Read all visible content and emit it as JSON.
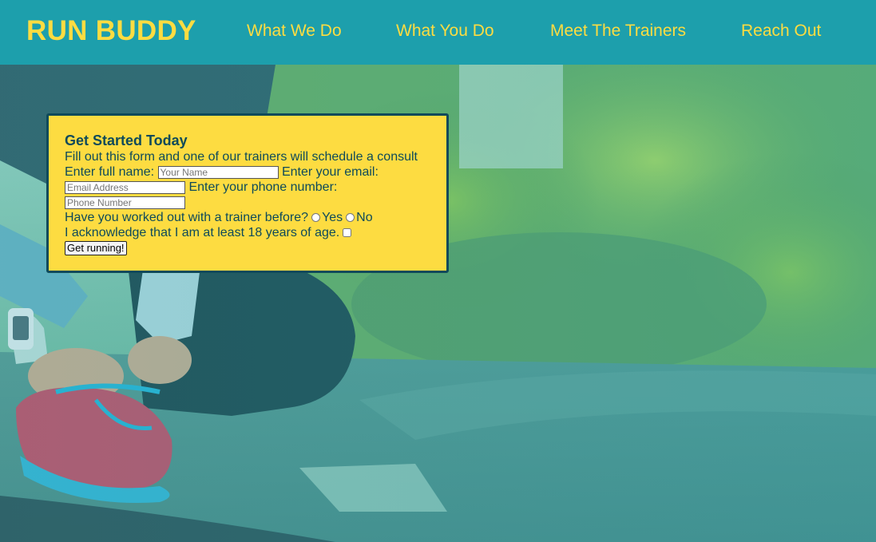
{
  "header": {
    "logo": "RUN BUDDY",
    "nav": [
      "What We Do",
      "What You Do",
      "Meet The Trainers",
      "Reach Out"
    ]
  },
  "form": {
    "title": "Get Started Today",
    "subtitle": "Fill out this form and one of our trainers will schedule a consult",
    "name_label": "Enter full name:",
    "name_placeholder": "Your Name",
    "email_label": "Enter your email:",
    "email_placeholder": "Email Address",
    "phone_label": "Enter your phone number:",
    "phone_placeholder": "Phone Number",
    "trainer_question": "Have you worked out with a trainer before?",
    "yes_label": "Yes",
    "no_label": "No",
    "age_label": "I acknowledge that I am at least 18 years of age.",
    "submit_label": "Get running!"
  },
  "colors": {
    "header_bg": "#1d9fac",
    "accent_yellow": "#fddc41",
    "dark_teal": "#0e4a5a"
  },
  "icons": {
    "hero": "runner-tying-shoe-photo"
  }
}
